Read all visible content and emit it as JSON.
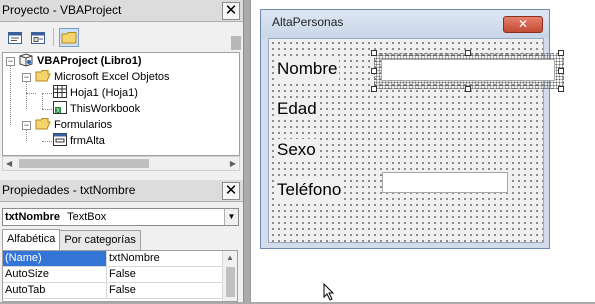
{
  "project_pane": {
    "title": "Proyecto - VBAProject",
    "close": "✕",
    "toolbar": {
      "view_code_icon": "view-code-icon",
      "view_object_icon": "view-object-icon",
      "toggle_folders_icon": "folder-icon"
    },
    "tree": {
      "root_label": "VBAProject (Libro1)",
      "excel_objects_label": "Microsoft Excel Objetos",
      "sheet1_label": "Hoja1 (Hoja1)",
      "workbook_label": "ThisWorkbook",
      "forms_label": "Formularios",
      "form_label": "frmAlta"
    }
  },
  "properties_pane": {
    "title": "Propiedades - txtNombre",
    "close": "✕",
    "object_name": "txtNombre",
    "object_type": "TextBox",
    "tabs": [
      "Alfabética",
      "Por categorías"
    ],
    "rows": [
      {
        "name": "(Name)",
        "value": "txtNombre"
      },
      {
        "name": "AutoSize",
        "value": "False"
      },
      {
        "name": "AutoTab",
        "value": "False"
      }
    ]
  },
  "form": {
    "title": "AltaPersonas",
    "close": "✕",
    "labels": {
      "nombre": "Nombre",
      "edad": "Edad",
      "sexo": "Sexo",
      "telefono": "Teléfono"
    }
  }
}
